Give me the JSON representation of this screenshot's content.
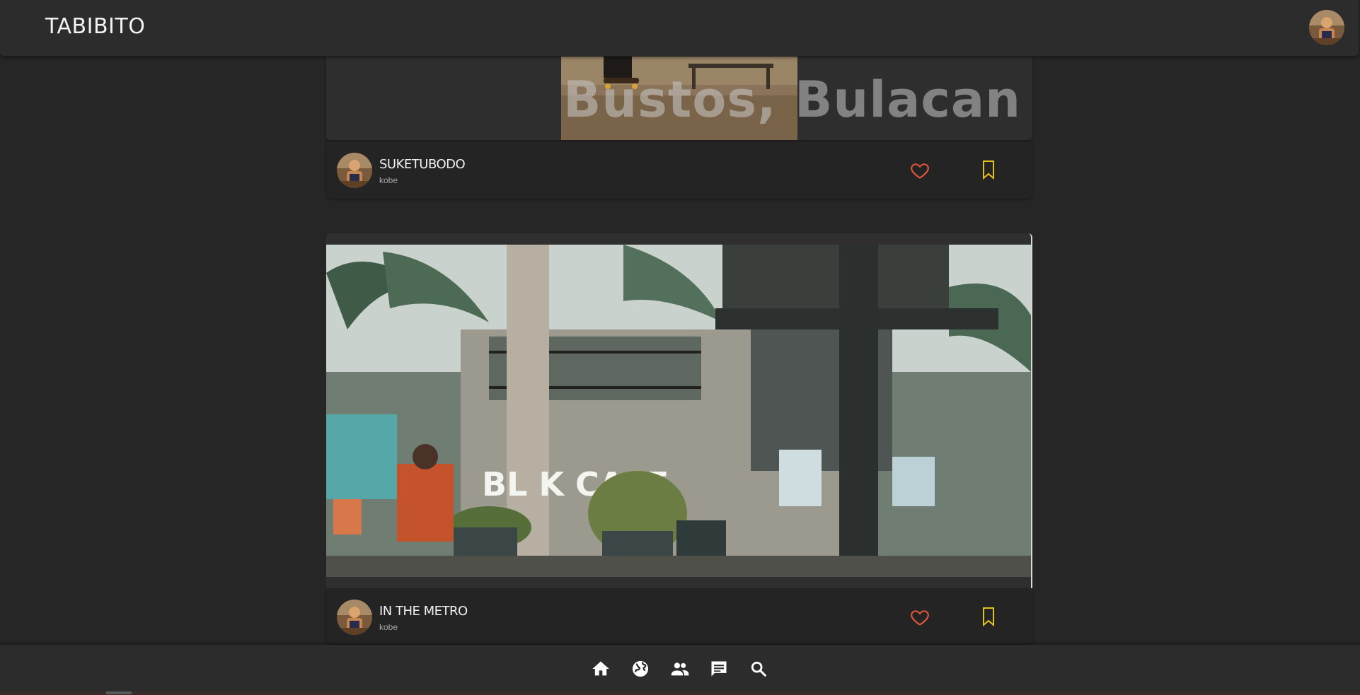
{
  "app": {
    "title": "TABIBITO"
  },
  "header": {
    "profile_avatar": "user-avatar"
  },
  "posts": [
    {
      "overlay_text": "Bustos, Bulacan",
      "title": "SUKETUBODO",
      "user": "kobe",
      "liked": false,
      "saved": false
    },
    {
      "overlay_text": "",
      "title": "IN THE METRO",
      "user": "kobe",
      "photo_sign": "BL  K CAFE",
      "liked": false,
      "saved": false
    }
  ],
  "bottom_nav": {
    "items": [
      {
        "name": "home",
        "icon": "home-icon"
      },
      {
        "name": "explore",
        "icon": "globe-icon"
      },
      {
        "name": "friends",
        "icon": "people-icon"
      },
      {
        "name": "messages",
        "icon": "chat-icon"
      },
      {
        "name": "search",
        "icon": "search-icon"
      }
    ]
  },
  "colors": {
    "background": "#262626",
    "bar": "#2c2c2c",
    "card": "#242424",
    "like": "#e8553e",
    "save": "#e2c21b",
    "icon": "#ffffff"
  }
}
